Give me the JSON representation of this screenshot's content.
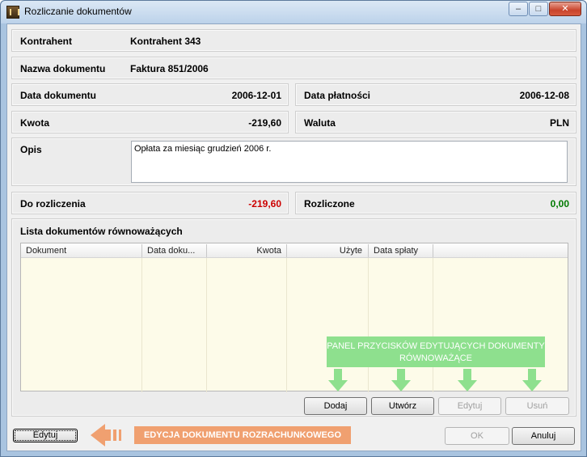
{
  "window": {
    "title": "Rozliczanie dokumentów",
    "minimize_glyph": "‒",
    "maximize_glyph": "□",
    "close_glyph": "✕"
  },
  "form": {
    "kontrahent_label": "Kontrahent",
    "kontrahent_value": "Kontrahent 343",
    "nazwa_label": "Nazwa dokumentu",
    "nazwa_value": "Faktura 851/2006",
    "data_dok_label": "Data dokumentu",
    "data_dok_value": "2006-12-01",
    "data_platn_label": "Data płatności",
    "data_platn_value": "2006-12-08",
    "kwota_label": "Kwota",
    "kwota_value": "-219,60",
    "waluta_label": "Waluta",
    "waluta_value": "PLN",
    "opis_label": "Opis",
    "opis_value": "Opłata za miesiąc grudzień 2006 r.",
    "do_rozl_label": "Do rozliczenia",
    "do_rozl_value": "-219,60",
    "rozliczone_label": "Rozliczone",
    "rozliczone_value": "0,00"
  },
  "list": {
    "title": "Lista dokumentów równoważących",
    "columns": [
      "Dokument",
      "Data doku...",
      "Kwota",
      "Użyte",
      "Data spłaty"
    ],
    "rows": []
  },
  "list_buttons": {
    "add": "Dodaj",
    "create": "Utwórz",
    "edit": "Edytuj",
    "delete": "Usuń"
  },
  "annotations": {
    "green_panel": "PANEL PRZYCISKÓW EDYTUJĄCYCH DOKUMENTY RÓWNOWAŻĄCE",
    "orange_label": "EDYCJA DOKUMENTU ROZRACHUNKOWEGO"
  },
  "footer": {
    "edit": "Edytuj",
    "ok": "OK",
    "cancel": "Anuluj"
  },
  "colors": {
    "negative": "#cc0000",
    "positive": "#007a00",
    "annotation_green": "#8ee08e",
    "annotation_orange": "#f0a070"
  }
}
